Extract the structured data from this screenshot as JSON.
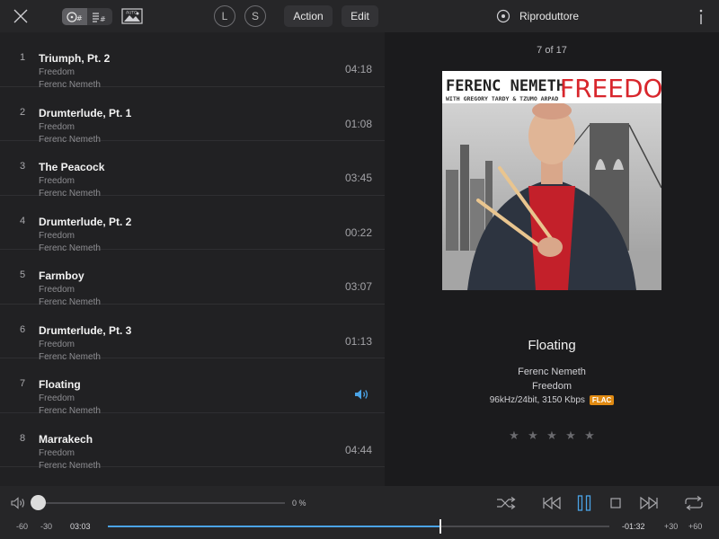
{
  "topbar": {
    "l_label": "L",
    "s_label": "S",
    "action_label": "Action",
    "edit_label": "Edit",
    "player_label": "Riproduttore",
    "auto_label": "AUTO"
  },
  "tracks": [
    {
      "num": "1",
      "title": "Triumph, Pt. 2",
      "album": "Freedom",
      "artist": "Ferenc Nemeth",
      "duration": "04:18"
    },
    {
      "num": "2",
      "title": "Drumterlude, Pt. 1",
      "album": "Freedom",
      "artist": "Ferenc Nemeth",
      "duration": "01:08"
    },
    {
      "num": "3",
      "title": "The Peacock",
      "album": "Freedom",
      "artist": "Ferenc Nemeth",
      "duration": "03:45"
    },
    {
      "num": "4",
      "title": "Drumterlude, Pt. 2",
      "album": "Freedom",
      "artist": "Ferenc Nemeth",
      "duration": "00:22"
    },
    {
      "num": "5",
      "title": "Farmboy",
      "album": "Freedom",
      "artist": "Ferenc Nemeth",
      "duration": "03:07"
    },
    {
      "num": "6",
      "title": "Drumterlude, Pt. 3",
      "album": "Freedom",
      "artist": "Ferenc Nemeth",
      "duration": "01:13"
    },
    {
      "num": "7",
      "title": "Floating",
      "album": "Freedom",
      "artist": "Ferenc Nemeth",
      "duration": ""
    },
    {
      "num": "8",
      "title": "Marrakech",
      "album": "Freedom",
      "artist": "Ferenc Nemeth",
      "duration": "04:44"
    }
  ],
  "now_playing": {
    "position": "7 of 17",
    "title": "Floating",
    "artist": "Ferenc Nemeth",
    "album": "Freedom",
    "quality": "96kHz/24bit, 3150 Kbps",
    "format_badge": "FLAC",
    "rating": 0,
    "cover": {
      "artist_text": "FERENC NEMETH",
      "album_text": "FREEDOM",
      "credits_text": "WITH GREGORY TARDY & TZUMO ARPAD"
    }
  },
  "player": {
    "volume_pct": "0 %",
    "volume_level": 0,
    "elapsed": "03:03",
    "remaining": "-01:32",
    "progress": 0.6637,
    "skip_back_60": "-60",
    "skip_back_30": "-30",
    "skip_fwd_30": "+30",
    "skip_fwd_60": "+60"
  },
  "colors": {
    "accent": "#4aa3e6",
    "badge": "#e08a12",
    "background": "#1f1f21",
    "cover_red": "#d8262c"
  },
  "icons": {
    "close": "close-icon",
    "library": "library-icon",
    "playlist": "playlist-icon",
    "auto_artwork": "image-icon",
    "player_tab": "player-icon",
    "info": "info-icon",
    "volume": "speaker-icon",
    "shuffle": "shuffle-icon",
    "previous": "previous-icon",
    "pause": "pause-icon",
    "stop": "stop-icon",
    "next": "next-icon",
    "repeat": "repeat-icon"
  }
}
